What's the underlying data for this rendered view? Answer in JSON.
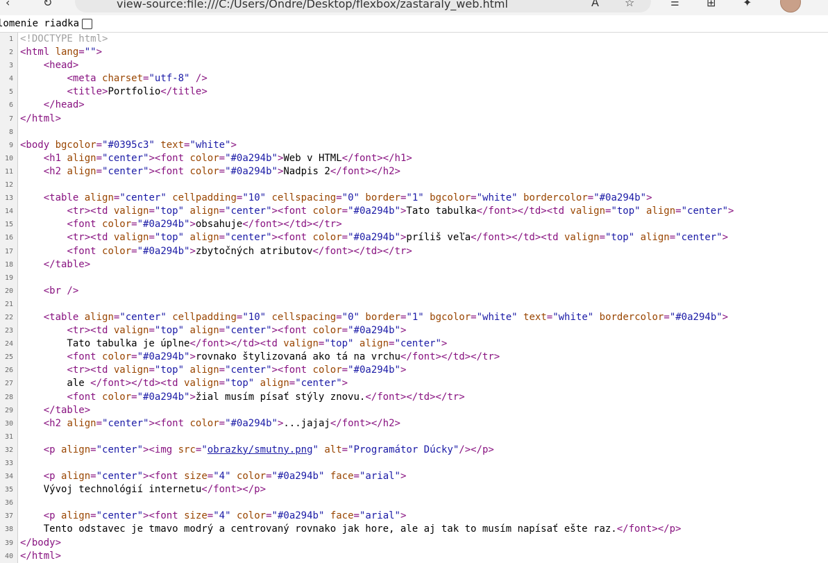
{
  "browser": {
    "url": "view-source:file:///C:/Users/Ondre/Desktop/flexbox/zastaraly_web.html",
    "back_glyph": "‹",
    "refresh_glyph": "↻"
  },
  "wrap": {
    "label": "lomenie riadka",
    "checked": false
  },
  "source": [
    {
      "n": "1",
      "tokens": [
        [
          "c",
          "<!DOCTYPE html>"
        ]
      ]
    },
    {
      "n": "2",
      "tokens": [
        [
          "t",
          "<html "
        ],
        [
          "a",
          "lang"
        ],
        [
          "t",
          "="
        ],
        [
          "v",
          "\"\""
        ],
        [
          "t",
          ">"
        ]
      ]
    },
    {
      "n": "3",
      "tokens": [
        [
          "x",
          "    "
        ],
        [
          "t",
          "<head>"
        ]
      ]
    },
    {
      "n": "4",
      "tokens": [
        [
          "x",
          "        "
        ],
        [
          "t",
          "<meta "
        ],
        [
          "a",
          "charset"
        ],
        [
          "t",
          "="
        ],
        [
          "v",
          "\"utf-8\""
        ],
        [
          "t",
          " />"
        ]
      ]
    },
    {
      "n": "5",
      "tokens": [
        [
          "x",
          "        "
        ],
        [
          "t",
          "<title>"
        ],
        [
          "x",
          "Portfolio"
        ],
        [
          "t",
          "</title>"
        ]
      ]
    },
    {
      "n": "6",
      "tokens": [
        [
          "x",
          "    "
        ],
        [
          "t",
          "</head>"
        ]
      ]
    },
    {
      "n": "7",
      "tokens": [
        [
          "t",
          "</html>"
        ]
      ]
    },
    {
      "n": "8",
      "tokens": []
    },
    {
      "n": "9",
      "tokens": [
        [
          "t",
          "<body "
        ],
        [
          "a",
          "bgcolor"
        ],
        [
          "t",
          "="
        ],
        [
          "v",
          "\"#0395c3\""
        ],
        [
          "a",
          " text"
        ],
        [
          "t",
          "="
        ],
        [
          "v",
          "\"white\""
        ],
        [
          "t",
          ">"
        ]
      ]
    },
    {
      "n": "10",
      "tokens": [
        [
          "x",
          "    "
        ],
        [
          "t",
          "<h1 "
        ],
        [
          "a",
          "align"
        ],
        [
          "t",
          "="
        ],
        [
          "v",
          "\"center\""
        ],
        [
          "t",
          "><font "
        ],
        [
          "a",
          "color"
        ],
        [
          "t",
          "="
        ],
        [
          "v",
          "\"#0a294b\""
        ],
        [
          "t",
          ">"
        ],
        [
          "x",
          "Web v HTML"
        ],
        [
          "t",
          "</font></h1>"
        ]
      ]
    },
    {
      "n": "11",
      "tokens": [
        [
          "x",
          "    "
        ],
        [
          "t",
          "<h2 "
        ],
        [
          "a",
          "align"
        ],
        [
          "t",
          "="
        ],
        [
          "v",
          "\"center\""
        ],
        [
          "t",
          "><font "
        ],
        [
          "a",
          "color"
        ],
        [
          "t",
          "="
        ],
        [
          "v",
          "\"#0a294b\""
        ],
        [
          "t",
          ">"
        ],
        [
          "x",
          "Nadpis 2"
        ],
        [
          "t",
          "</font></h2>"
        ]
      ]
    },
    {
      "n": "12",
      "tokens": []
    },
    {
      "n": "13",
      "tokens": [
        [
          "x",
          "    "
        ],
        [
          "t",
          "<table "
        ],
        [
          "a",
          "align"
        ],
        [
          "t",
          "="
        ],
        [
          "v",
          "\"center\""
        ],
        [
          "a",
          " cellpadding"
        ],
        [
          "t",
          "="
        ],
        [
          "v",
          "\"10\""
        ],
        [
          "a",
          " cellspacing"
        ],
        [
          "t",
          "="
        ],
        [
          "v",
          "\"0\""
        ],
        [
          "a",
          " border"
        ],
        [
          "t",
          "="
        ],
        [
          "v",
          "\"1\""
        ],
        [
          "a",
          " bgcolor"
        ],
        [
          "t",
          "="
        ],
        [
          "v",
          "\"white\""
        ],
        [
          "a",
          " bordercolor"
        ],
        [
          "t",
          "="
        ],
        [
          "v",
          "\"#0a294b\""
        ],
        [
          "t",
          ">"
        ]
      ]
    },
    {
      "n": "14",
      "tokens": [
        [
          "x",
          "        "
        ],
        [
          "t",
          "<tr><td "
        ],
        [
          "a",
          "valign"
        ],
        [
          "t",
          "="
        ],
        [
          "v",
          "\"top\""
        ],
        [
          "a",
          " align"
        ],
        [
          "t",
          "="
        ],
        [
          "v",
          "\"center\""
        ],
        [
          "t",
          "><font "
        ],
        [
          "a",
          "color"
        ],
        [
          "t",
          "="
        ],
        [
          "v",
          "\"#0a294b\""
        ],
        [
          "t",
          ">"
        ],
        [
          "x",
          "Tato tabulka"
        ],
        [
          "t",
          "</font></td><td "
        ],
        [
          "a",
          "valign"
        ],
        [
          "t",
          "="
        ],
        [
          "v",
          "\"top\""
        ],
        [
          "a",
          " align"
        ],
        [
          "t",
          "="
        ],
        [
          "v",
          "\"center\""
        ],
        [
          "t",
          ">"
        ]
      ]
    },
    {
      "n": "15",
      "tokens": [
        [
          "x",
          "        "
        ],
        [
          "t",
          "<font "
        ],
        [
          "a",
          "color"
        ],
        [
          "t",
          "="
        ],
        [
          "v",
          "\"#0a294b\""
        ],
        [
          "t",
          ">"
        ],
        [
          "x",
          "obsahuje"
        ],
        [
          "t",
          "</font></td></tr>"
        ]
      ]
    },
    {
      "n": "16",
      "tokens": [
        [
          "x",
          "        "
        ],
        [
          "t",
          "<tr><td "
        ],
        [
          "a",
          "valign"
        ],
        [
          "t",
          "="
        ],
        [
          "v",
          "\"top\""
        ],
        [
          "a",
          " align"
        ],
        [
          "t",
          "="
        ],
        [
          "v",
          "\"center\""
        ],
        [
          "t",
          "><font "
        ],
        [
          "a",
          "color"
        ],
        [
          "t",
          "="
        ],
        [
          "v",
          "\"#0a294b\""
        ],
        [
          "t",
          ">"
        ],
        [
          "x",
          "príliš veľa"
        ],
        [
          "t",
          "</font></td><td "
        ],
        [
          "a",
          "valign"
        ],
        [
          "t",
          "="
        ],
        [
          "v",
          "\"top\""
        ],
        [
          "a",
          " align"
        ],
        [
          "t",
          "="
        ],
        [
          "v",
          "\"center\""
        ],
        [
          "t",
          ">"
        ]
      ]
    },
    {
      "n": "17",
      "tokens": [
        [
          "x",
          "        "
        ],
        [
          "t",
          "<font "
        ],
        [
          "a",
          "color"
        ],
        [
          "t",
          "="
        ],
        [
          "v",
          "\"#0a294b\""
        ],
        [
          "t",
          ">"
        ],
        [
          "x",
          "zbytočných atributov"
        ],
        [
          "t",
          "</font></td></tr>"
        ]
      ]
    },
    {
      "n": "18",
      "tokens": [
        [
          "x",
          "    "
        ],
        [
          "t",
          "</table>"
        ]
      ]
    },
    {
      "n": "19",
      "tokens": []
    },
    {
      "n": "20",
      "tokens": [
        [
          "x",
          "    "
        ],
        [
          "t",
          "<br />"
        ]
      ]
    },
    {
      "n": "21",
      "tokens": []
    },
    {
      "n": "22",
      "tokens": [
        [
          "x",
          "    "
        ],
        [
          "t",
          "<table "
        ],
        [
          "a",
          "align"
        ],
        [
          "t",
          "="
        ],
        [
          "v",
          "\"center\""
        ],
        [
          "a",
          " cellpadding"
        ],
        [
          "t",
          "="
        ],
        [
          "v",
          "\"10\""
        ],
        [
          "a",
          " cellspacing"
        ],
        [
          "t",
          "="
        ],
        [
          "v",
          "\"0\""
        ],
        [
          "a",
          " border"
        ],
        [
          "t",
          "="
        ],
        [
          "v",
          "\"1\""
        ],
        [
          "a",
          " bgcolor"
        ],
        [
          "t",
          "="
        ],
        [
          "v",
          "\"white\""
        ],
        [
          "a",
          " text"
        ],
        [
          "t",
          "="
        ],
        [
          "v",
          "\"white\""
        ],
        [
          "a",
          " bordercolor"
        ],
        [
          "t",
          "="
        ],
        [
          "v",
          "\"#0a294b\""
        ],
        [
          "t",
          ">"
        ]
      ]
    },
    {
      "n": "23",
      "tokens": [
        [
          "x",
          "        "
        ],
        [
          "t",
          "<tr><td "
        ],
        [
          "a",
          "valign"
        ],
        [
          "t",
          "="
        ],
        [
          "v",
          "\"top\""
        ],
        [
          "a",
          " align"
        ],
        [
          "t",
          "="
        ],
        [
          "v",
          "\"center\""
        ],
        [
          "t",
          "><font "
        ],
        [
          "a",
          "color"
        ],
        [
          "t",
          "="
        ],
        [
          "v",
          "\"#0a294b\""
        ],
        [
          "t",
          ">"
        ]
      ]
    },
    {
      "n": "24",
      "tokens": [
        [
          "x",
          "        Tato tabulka je úplne"
        ],
        [
          "t",
          "</font></td><td "
        ],
        [
          "a",
          "valign"
        ],
        [
          "t",
          "="
        ],
        [
          "v",
          "\"top\""
        ],
        [
          "a",
          " align"
        ],
        [
          "t",
          "="
        ],
        [
          "v",
          "\"center\""
        ],
        [
          "t",
          ">"
        ]
      ]
    },
    {
      "n": "25",
      "tokens": [
        [
          "x",
          "        "
        ],
        [
          "t",
          "<font "
        ],
        [
          "a",
          "color"
        ],
        [
          "t",
          "="
        ],
        [
          "v",
          "\"#0a294b\""
        ],
        [
          "t",
          ">"
        ],
        [
          "x",
          "rovnako štylizovaná ako tá na vrchu"
        ],
        [
          "t",
          "</font></td></tr>"
        ]
      ]
    },
    {
      "n": "26",
      "tokens": [
        [
          "x",
          "        "
        ],
        [
          "t",
          "<tr><td "
        ],
        [
          "a",
          "valign"
        ],
        [
          "t",
          "="
        ],
        [
          "v",
          "\"top\""
        ],
        [
          "a",
          " align"
        ],
        [
          "t",
          "="
        ],
        [
          "v",
          "\"center\""
        ],
        [
          "t",
          "><font "
        ],
        [
          "a",
          "color"
        ],
        [
          "t",
          "="
        ],
        [
          "v",
          "\"#0a294b\""
        ],
        [
          "t",
          ">"
        ]
      ]
    },
    {
      "n": "27",
      "tokens": [
        [
          "x",
          "        ale "
        ],
        [
          "t",
          "</font></td><td "
        ],
        [
          "a",
          "valign"
        ],
        [
          "t",
          "="
        ],
        [
          "v",
          "\"top\""
        ],
        [
          "a",
          " align"
        ],
        [
          "t",
          "="
        ],
        [
          "v",
          "\"center\""
        ],
        [
          "t",
          ">"
        ]
      ]
    },
    {
      "n": "28",
      "tokens": [
        [
          "x",
          "        "
        ],
        [
          "t",
          "<font "
        ],
        [
          "a",
          "color"
        ],
        [
          "t",
          "="
        ],
        [
          "v",
          "\"#0a294b\""
        ],
        [
          "t",
          ">"
        ],
        [
          "x",
          "žial musím písať stýly znovu."
        ],
        [
          "t",
          "</font></td></tr>"
        ]
      ]
    },
    {
      "n": "29",
      "tokens": [
        [
          "x",
          "    "
        ],
        [
          "t",
          "</table>"
        ]
      ]
    },
    {
      "n": "30",
      "tokens": [
        [
          "x",
          "    "
        ],
        [
          "t",
          "<h2 "
        ],
        [
          "a",
          "align"
        ],
        [
          "t",
          "="
        ],
        [
          "v",
          "\"center\""
        ],
        [
          "t",
          "><font "
        ],
        [
          "a",
          "color"
        ],
        [
          "t",
          "="
        ],
        [
          "v",
          "\"#0a294b\""
        ],
        [
          "t",
          ">"
        ],
        [
          "x",
          "...jajaj"
        ],
        [
          "t",
          "</font></h2>"
        ]
      ]
    },
    {
      "n": "31",
      "tokens": []
    },
    {
      "n": "32",
      "tokens": [
        [
          "x",
          "    "
        ],
        [
          "t",
          "<p "
        ],
        [
          "a",
          "align"
        ],
        [
          "t",
          "="
        ],
        [
          "v",
          "\"center\""
        ],
        [
          "t",
          "><img "
        ],
        [
          "a",
          "src"
        ],
        [
          "t",
          "="
        ],
        [
          "v",
          "\""
        ],
        [
          "lk",
          "obrazky/smutny.png"
        ],
        [
          "v",
          "\""
        ],
        [
          "a",
          " alt"
        ],
        [
          "t",
          "="
        ],
        [
          "v",
          "\"Programátor Dúcky\""
        ],
        [
          "t",
          "/></p>"
        ]
      ]
    },
    {
      "n": "33",
      "tokens": []
    },
    {
      "n": "34",
      "tokens": [
        [
          "x",
          "    "
        ],
        [
          "t",
          "<p "
        ],
        [
          "a",
          "align"
        ],
        [
          "t",
          "="
        ],
        [
          "v",
          "\"center\""
        ],
        [
          "t",
          "><font "
        ],
        [
          "a",
          "size"
        ],
        [
          "t",
          "="
        ],
        [
          "v",
          "\"4\""
        ],
        [
          "a",
          " color"
        ],
        [
          "t",
          "="
        ],
        [
          "v",
          "\"#0a294b\""
        ],
        [
          "a",
          " face"
        ],
        [
          "t",
          "="
        ],
        [
          "v",
          "\"arial\""
        ],
        [
          "t",
          ">"
        ]
      ]
    },
    {
      "n": "35",
      "tokens": [
        [
          "x",
          "    Vývoj technológií internetu"
        ],
        [
          "t",
          "</font></p>"
        ]
      ]
    },
    {
      "n": "36",
      "tokens": []
    },
    {
      "n": "37",
      "tokens": [
        [
          "x",
          "    "
        ],
        [
          "t",
          "<p "
        ],
        [
          "a",
          "align"
        ],
        [
          "t",
          "="
        ],
        [
          "v",
          "\"center\""
        ],
        [
          "t",
          "><font "
        ],
        [
          "a",
          "size"
        ],
        [
          "t",
          "="
        ],
        [
          "v",
          "\"4\""
        ],
        [
          "a",
          " color"
        ],
        [
          "t",
          "="
        ],
        [
          "v",
          "\"#0a294b\""
        ],
        [
          "a",
          " face"
        ],
        [
          "t",
          "="
        ],
        [
          "v",
          "\"arial\""
        ],
        [
          "t",
          ">"
        ]
      ]
    },
    {
      "n": "38",
      "tokens": [
        [
          "x",
          "    Tento odstavec je tmavo modrý a centrovaný rovnako jak hore, ale aj tak to musím napísať ešte raz."
        ],
        [
          "t",
          "</font></p>"
        ]
      ]
    },
    {
      "n": "39",
      "tokens": [
        [
          "t",
          "</body>"
        ]
      ]
    },
    {
      "n": "40",
      "tokens": [
        [
          "t",
          "</html>"
        ]
      ]
    }
  ]
}
